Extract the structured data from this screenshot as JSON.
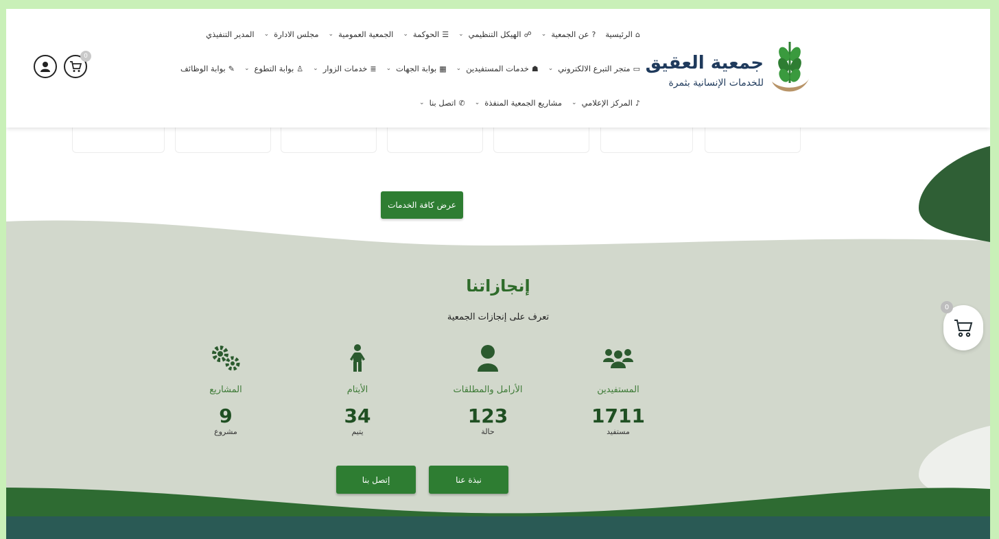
{
  "org": {
    "name": "جمعية العقيق",
    "subtitle": "للخدمات الإنسانية بثمرة"
  },
  "nav": {
    "row1": [
      {
        "label": "الرئيسية",
        "icon": "home-icon",
        "glyph": "⌂",
        "dropdown": false
      },
      {
        "label": "عن الجمعية",
        "icon": "question-icon",
        "glyph": "?",
        "dropdown": true
      },
      {
        "label": "الهيكل التنظيمي",
        "icon": "sitemap-icon",
        "glyph": "☍",
        "dropdown": true
      },
      {
        "label": "الحوكمة",
        "icon": "list-icon",
        "glyph": "☰",
        "dropdown": true
      },
      {
        "label": "الجمعية العمومية",
        "icon": "",
        "glyph": "",
        "dropdown": true
      },
      {
        "label": "مجلس الادارة",
        "icon": "",
        "glyph": "",
        "dropdown": true
      },
      {
        "label": "المدير التنفيذي",
        "icon": "",
        "glyph": "",
        "dropdown": false
      }
    ],
    "row2": [
      {
        "label": "متجر التبرع الالكتروني",
        "icon": "card-icon",
        "glyph": "▭",
        "dropdown": true
      },
      {
        "label": "خدمات المستفيدين",
        "icon": "users-icon",
        "glyph": "☗",
        "dropdown": true
      },
      {
        "label": "بوابة الجهات",
        "icon": "building-icon",
        "glyph": "▦",
        "dropdown": true
      },
      {
        "label": "خدمات الزوار",
        "icon": "server-icon",
        "glyph": "≣",
        "dropdown": true
      },
      {
        "label": "بوابة التطوع",
        "icon": "volunteer-icon",
        "glyph": "♙",
        "dropdown": true
      },
      {
        "label": "بوابة الوظائف",
        "icon": "edit-icon",
        "glyph": "✎",
        "dropdown": false
      }
    ],
    "row3": [
      {
        "label": "المركز الإعلامي",
        "icon": "microphone-icon",
        "glyph": "♪",
        "dropdown": true
      },
      {
        "label": "مشاريع الجمعية المنفذة",
        "icon": "",
        "glyph": "",
        "dropdown": true
      },
      {
        "label": "اتصل بنا",
        "icon": "phone-icon",
        "glyph": "✆",
        "dropdown": true
      }
    ]
  },
  "header_cart": {
    "count": "0"
  },
  "services_button": "عرض كافة الخدمات",
  "achievements": {
    "title": "إنجازاتنا",
    "subtitle": "تعرف على إنجازات الجمعية",
    "stats": [
      {
        "label": "المستفيدين",
        "value": "1711",
        "unit": "مستفيد",
        "icon": "users-group-icon"
      },
      {
        "label": "الأرامل والمطلقات",
        "value": "123",
        "unit": "حالة",
        "icon": "user-icon"
      },
      {
        "label": "الأيتام",
        "value": "34",
        "unit": "يتيم",
        "icon": "child-icon"
      },
      {
        "label": "المشاريع",
        "value": "9",
        "unit": "مشروع",
        "icon": "gears-icon"
      }
    ],
    "about_button": "نبذة عنا",
    "contact_button": "إتصل بنا"
  },
  "floating_cart": {
    "count": "0"
  },
  "colors": {
    "primary_green": "#2e7d32",
    "dark_green": "#2b5a2e",
    "section_bg": "#d2d8cc",
    "footer_teal": "#2a5a55"
  }
}
